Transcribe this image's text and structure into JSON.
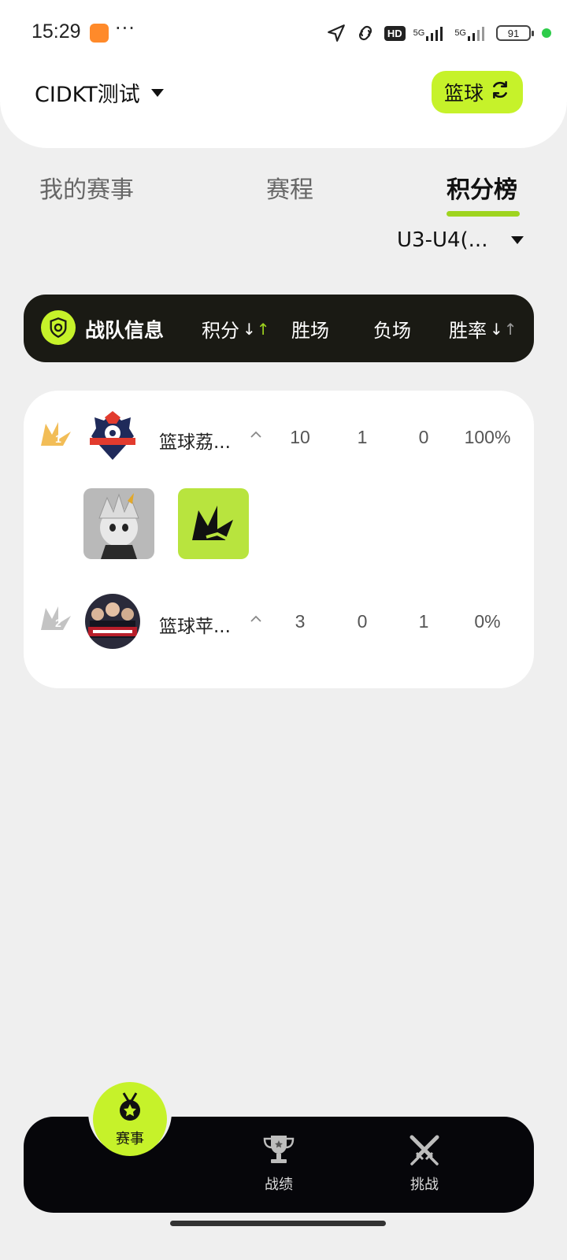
{
  "status": {
    "time": "15:29",
    "more": "···",
    "hd": "HD",
    "sig1": "5G",
    "sig2": "5G",
    "battery": "91"
  },
  "header": {
    "org": "CIDKT测试",
    "sport": "篮球"
  },
  "tabs": [
    {
      "label": "我的赛事"
    },
    {
      "label": "赛程"
    },
    {
      "label": "积分榜",
      "active": true
    }
  ],
  "group_filter": "U3-U4(...",
  "table": {
    "columns": {
      "team": "战队信息",
      "points": "积分",
      "wins": "胜场",
      "losses": "负场",
      "win_rate": "胜率"
    },
    "rows": [
      {
        "rank": "1",
        "name": "篮球荔...",
        "points": "10",
        "wins": "1",
        "losses": "0",
        "win_rate": "100%"
      },
      {
        "rank": "2",
        "name": "篮球苹...",
        "points": "3",
        "wins": "0",
        "losses": "1",
        "win_rate": "0%"
      }
    ]
  },
  "bottom_nav": {
    "main": "赛事",
    "record": "战绩",
    "challenge": "挑战"
  },
  "colors": {
    "accent": "#c6f22a",
    "dark": "#1a1a14",
    "nav": "#06060a",
    "rank1": "#f0b23a",
    "rank2": "#bdbdbd"
  }
}
